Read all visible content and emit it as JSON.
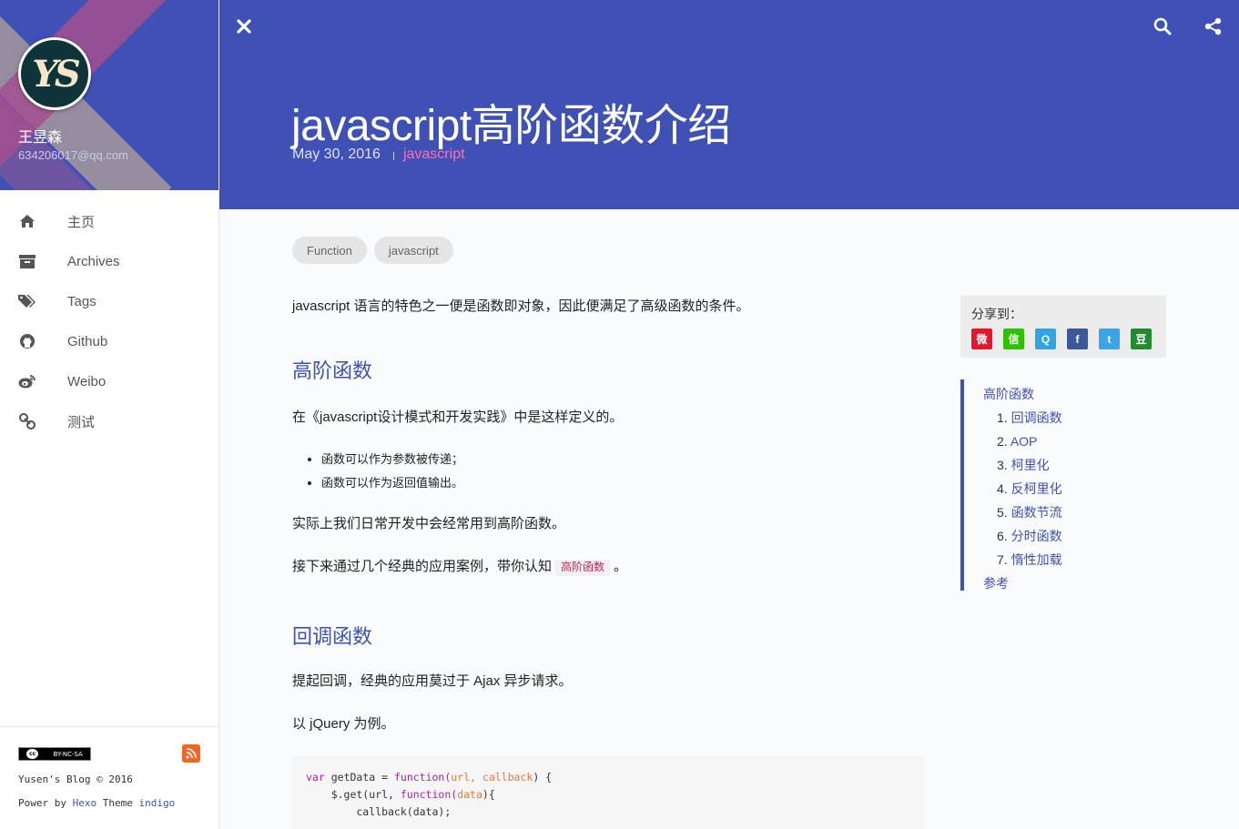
{
  "profile": {
    "name": "王昱森",
    "email": "634206017@qq.com",
    "avatar_text": "YS"
  },
  "nav": [
    {
      "label": "主页",
      "icon": "home-icon"
    },
    {
      "label": "Archives",
      "icon": "archive-icon"
    },
    {
      "label": "Tags",
      "icon": "tags-icon"
    },
    {
      "label": "Github",
      "icon": "github-icon"
    },
    {
      "label": "Weibo",
      "icon": "weibo-icon"
    },
    {
      "label": "测试",
      "icon": "link-icon"
    }
  ],
  "footer": {
    "license": "BY-NC-SA",
    "copyright": "Yusen's Blog © 2016",
    "power_prefix": "Power by",
    "hexo": "Hexo",
    "theme_label": "Theme",
    "theme": "indigo"
  },
  "post": {
    "title": "javascript高阶函数介绍",
    "date": "May 30, 2016",
    "category": "javascript",
    "tags": [
      "Function",
      "javascript"
    ]
  },
  "article": {
    "intro": "javascript 语言的特色之一便是函数即对象，因此便满足了高级函数的条件。",
    "h1": "高阶函数",
    "p_def": "在《javascript设计模式和开发实践》中是这样定义的。",
    "bullets": [
      "函数可以作为参数被传递；",
      "函数可以作为返回值输出。"
    ],
    "p_usage": "实际上我们日常开发中会经常用到高阶函数。",
    "p_next_pre": "接下来通过几个经典的应用案例，带你认知",
    "p_next_code": "高阶函数",
    "p_next_post": "。",
    "h2": "回调函数",
    "p_callback": "提起回调，经典的应用莫过于 Ajax 异步请求。",
    "p_jquery": "以 jQuery 为例。",
    "code": {
      "l1": {
        "kw": "var",
        "name": "getData",
        "eq": " = ",
        "fn": "function",
        "open": "(",
        "params": "url, callback",
        "close": ") {"
      },
      "l2": {
        "pre": "    $.get(url, ",
        "fn": "function",
        "open": "(",
        "params": "data",
        "close": "){"
      },
      "l3": "        callback(data);"
    }
  },
  "share": {
    "title": "分享到：",
    "items": [
      {
        "name": "weibo",
        "glyph": "微",
        "color": "#e6162d"
      },
      {
        "name": "wechat",
        "glyph": "信",
        "color": "#2dc100"
      },
      {
        "name": "qq",
        "glyph": "Q",
        "color": "#31a5e2"
      },
      {
        "name": "facebook",
        "glyph": "f",
        "color": "#3b5998"
      },
      {
        "name": "twitter",
        "glyph": "t",
        "color": "#3aa4e8"
      },
      {
        "name": "douban",
        "glyph": "豆",
        "color": "#228a31"
      }
    ]
  },
  "toc": {
    "top": "高阶函数",
    "items": [
      {
        "num": "1.",
        "label": "回调函数"
      },
      {
        "num": "2.",
        "label": "AOP"
      },
      {
        "num": "3.",
        "label": "柯里化"
      },
      {
        "num": "4.",
        "label": "反柯里化"
      },
      {
        "num": "5.",
        "label": "函数节流"
      },
      {
        "num": "6.",
        "label": "分时函数"
      },
      {
        "num": "7.",
        "label": "惰性加载"
      }
    ],
    "last": "参考"
  },
  "colors": {
    "primary": "#3f51b5",
    "category": "#ff6fb2",
    "inline_code": "#c7254e"
  }
}
